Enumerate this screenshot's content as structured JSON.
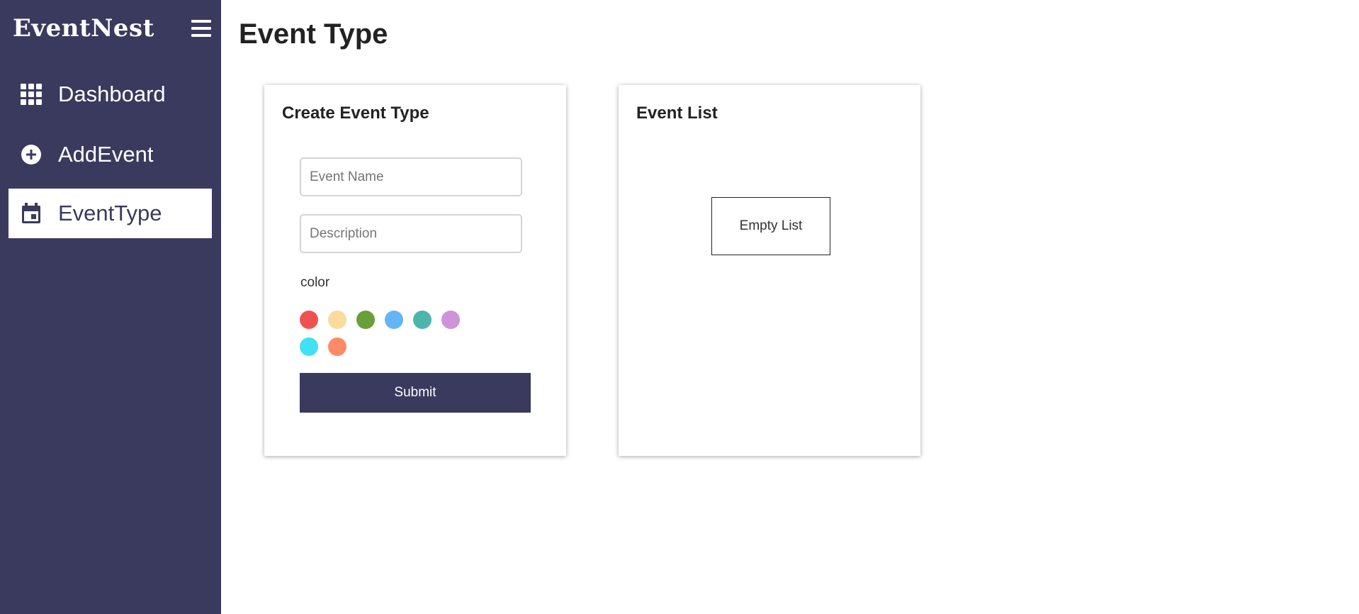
{
  "app": {
    "brand": "EventNest"
  },
  "sidebar": {
    "items": [
      {
        "label": "Dashboard",
        "icon": "grid-icon",
        "active": false
      },
      {
        "label": "AddEvent",
        "icon": "add-circle-icon",
        "active": false
      },
      {
        "label": "EventType",
        "icon": "calendar-icon",
        "active": true
      }
    ]
  },
  "page": {
    "title": "Event Type"
  },
  "create_card": {
    "title": "Create Event Type",
    "event_name_placeholder": "Event Name",
    "description_placeholder": "Description",
    "color_label": "color",
    "colors": [
      "#ef5350",
      "#f7dc9c",
      "#689f38",
      "#64b5f6",
      "#4db6ac",
      "#ce93d8",
      "#40e0f5",
      "#ff8a65"
    ],
    "submit_label": "Submit"
  },
  "list_card": {
    "title": "Event List",
    "empty_text": "Empty List"
  },
  "theme": {
    "sidebar_bg": "#3a3a5e",
    "accent": "#3a3a5e"
  }
}
